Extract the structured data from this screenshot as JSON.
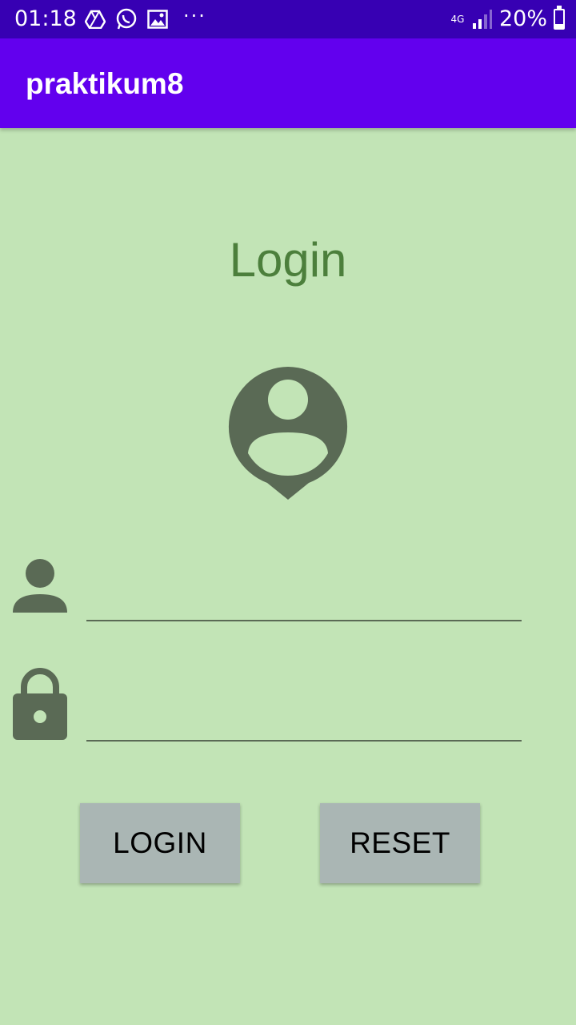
{
  "status_bar": {
    "time": "01:18",
    "left_icons": [
      "drive-icon",
      "whatsapp-icon",
      "gallery-icon"
    ],
    "more": "···",
    "network": "4G",
    "battery": "20%"
  },
  "app_bar": {
    "title": "praktikum8"
  },
  "screen": {
    "heading": "Login",
    "username_field": {
      "value": "",
      "placeholder": ""
    },
    "password_field": {
      "value": "",
      "placeholder": ""
    },
    "login_button": "LOGIN",
    "reset_button": "RESET"
  },
  "colors": {
    "status_bar": "#3700b3",
    "app_bar": "#6200ee",
    "background": "#c2e4b6",
    "heading": "#4c7f3c",
    "icon": "#5a6a55",
    "button": "#aab6b4"
  }
}
